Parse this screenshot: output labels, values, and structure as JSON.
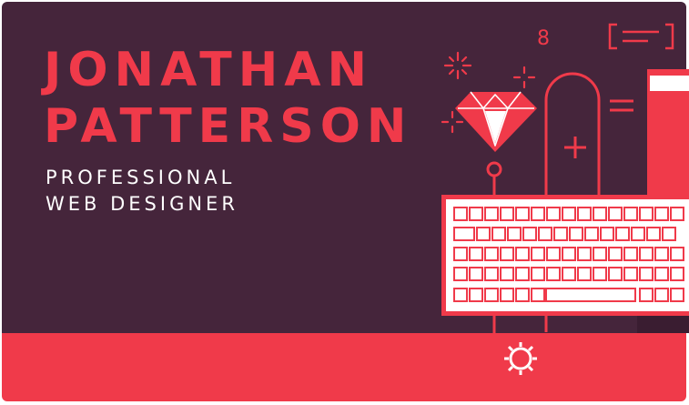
{
  "card": {
    "name_line1": "JONATHAN",
    "name_line2": "PATTERSON",
    "title_line1": "PROFESSIONAL",
    "title_line2": "WEB DESIGNER"
  },
  "decor": {
    "digit_label": "8",
    "equals_sign": "="
  },
  "colors": {
    "background": "#45253b",
    "accent": "#f03a4a",
    "text_light": "#ffffff"
  },
  "icons": [
    "sparkle-icon",
    "diamond-icon",
    "keyboard-icon",
    "gear-icon",
    "code-bracket-icon",
    "plus-icon"
  ]
}
